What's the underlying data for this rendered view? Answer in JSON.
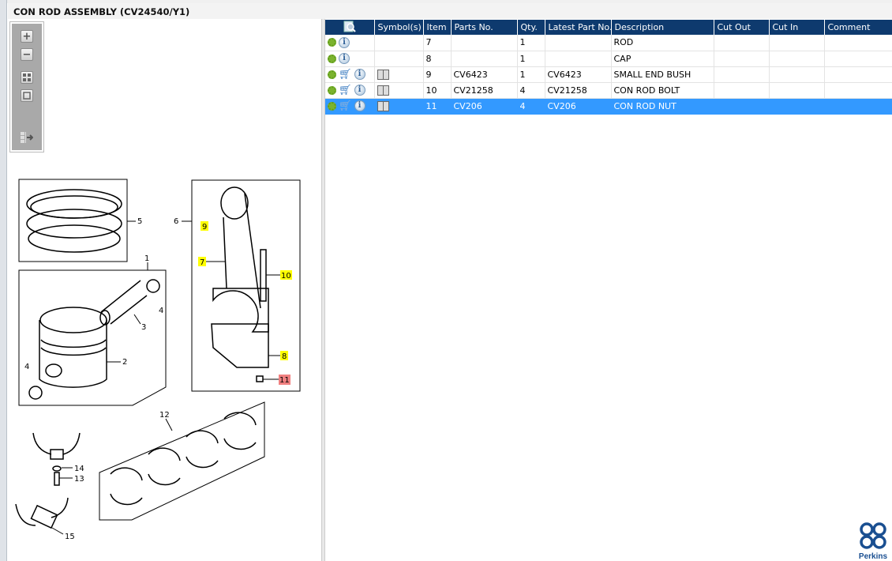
{
  "title": "CON ROD ASSEMBLY (CV24540/Y1)",
  "toolbar": {
    "zoom_in": "+",
    "zoom_out": "−"
  },
  "table": {
    "columns": [
      "Symbol(s)",
      "Item",
      "Parts No.",
      "Qty.",
      "Latest Part No.",
      "Description",
      "Cut Out",
      "Cut In",
      "Comment"
    ],
    "rows": [
      {
        "item": "7",
        "parts_no": "",
        "qty": "1",
        "latest": "",
        "description": "ROD",
        "cart": false,
        "book": false
      },
      {
        "item": "8",
        "parts_no": "",
        "qty": "1",
        "latest": "",
        "description": "CAP",
        "cart": false,
        "book": false
      },
      {
        "item": "9",
        "parts_no": "CV6423",
        "qty": "1",
        "latest": "CV6423",
        "description": "SMALL END BUSH",
        "cart": true,
        "book": true
      },
      {
        "item": "10",
        "parts_no": "CV21258",
        "qty": "4",
        "latest": "CV21258",
        "description": "CON ROD BOLT",
        "cart": true,
        "book": true
      },
      {
        "item": "11",
        "parts_no": "CV206",
        "qty": "4",
        "latest": "CV206",
        "description": "CON ROD NUT",
        "cart": true,
        "book": true,
        "selected": true
      }
    ]
  },
  "diagram": {
    "callouts": {
      "c1": "1",
      "c2": "2",
      "c3": "3",
      "c4a": "4",
      "c4b": "4",
      "c5": "5",
      "c6": "6",
      "c7": "7",
      "c8": "8",
      "c9": "9",
      "c10": "10",
      "c11": "11",
      "c12": "12",
      "c13": "13",
      "c14": "14",
      "c15": "15"
    },
    "highlight_color": "#ffff00",
    "selected_color": "#f08080"
  },
  "brand": "Perkins"
}
